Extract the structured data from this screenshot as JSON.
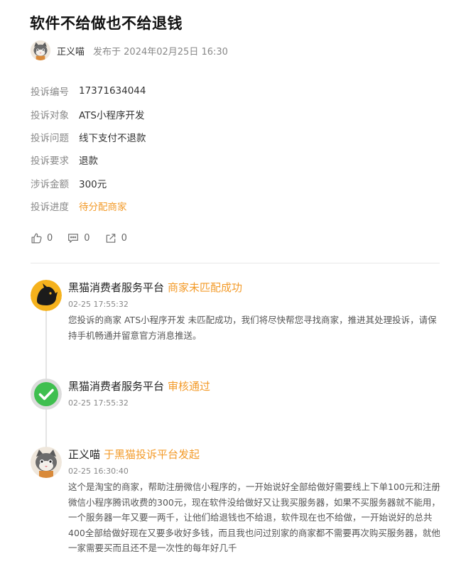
{
  "complaint": {
    "title": "软件不给做也不给退钱",
    "author": "正义喵",
    "publish_text": "发布于 2024年02月25日 16:30"
  },
  "info": [
    {
      "label": "投诉编号",
      "value": "17371634044",
      "highlight": false
    },
    {
      "label": "投诉对象",
      "value": "ATS小程序开发",
      "highlight": false
    },
    {
      "label": "投诉问题",
      "value": "线下支付不退款",
      "highlight": false
    },
    {
      "label": "投诉要求",
      "value": "退款",
      "highlight": false
    },
    {
      "label": "涉诉金额",
      "value": "300元",
      "highlight": false
    },
    {
      "label": "投诉进度",
      "value": "待分配商家",
      "highlight": true
    }
  ],
  "actions": {
    "like_count": "0",
    "comment_count": "0",
    "share_count": "0"
  },
  "timeline": [
    {
      "name": "黑猫消费者服务平台",
      "status": "商家未匹配成功",
      "time": "02-25 17:55:32",
      "text": "您投诉的商家 ATS小程序开发 未匹配成功，我们将尽快帮您寻找商家，推进其处理投诉，请保持手机畅通并留意官方消息推送。",
      "avatar": "black-cat-icon"
    },
    {
      "name": "黑猫消费者服务平台",
      "status": "审核通过",
      "time": "02-25 17:55:32",
      "text": "",
      "avatar": "check-icon"
    },
    {
      "name": "正义喵",
      "status": "于黑猫投诉平台发起",
      "time": "02-25 16:30:40",
      "text": "这个是淘宝的商家，帮助注册微信小程序的，一开始说好全部给做好需要线上下单100元和注册微信小程序腾讯收费的300元，现在软件没给做好又让我买服务器，如果不买服务器就不能用，一个服务器一年又要一两千，让他们给退钱也不给退，软件现在也不给做，一开始说好的总共400全部给做好现在又要多收好多钱，而且我也问过别家的商家都不需要再次购买服务器，就他一家需要买而且还不是一次性的每年好几千",
      "avatar": "cat-avatar-icon"
    }
  ],
  "colors": {
    "accent_orange": "#f39b2a",
    "success_green": "#3fbf4f",
    "brand_yellow": "#f5b21d"
  }
}
